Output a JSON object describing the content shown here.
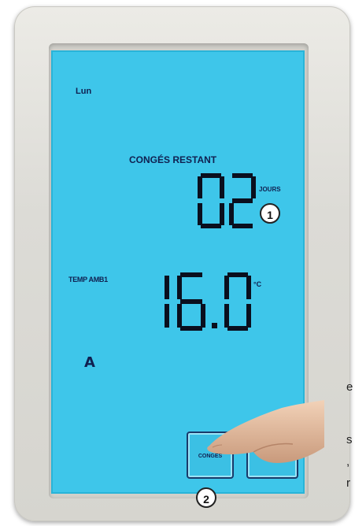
{
  "display": {
    "day": "Lun",
    "conges_label": "CONGÉS RESTANT",
    "days_value": "02",
    "days_unit": "JOURS",
    "temp_label": "TEMP AMB1",
    "temp_value": "16.0",
    "temp_unit": "°C",
    "mode": "A"
  },
  "buttons": {
    "conges_label": "CONGÉS"
  },
  "callouts": {
    "one": "1",
    "two": "2"
  },
  "side_text": [
    "e",
    "s",
    ",",
    "r"
  ],
  "colors": {
    "screen": "#3ec6ea",
    "segment": "#0a0f1e",
    "housing": "#dcdbd6"
  }
}
